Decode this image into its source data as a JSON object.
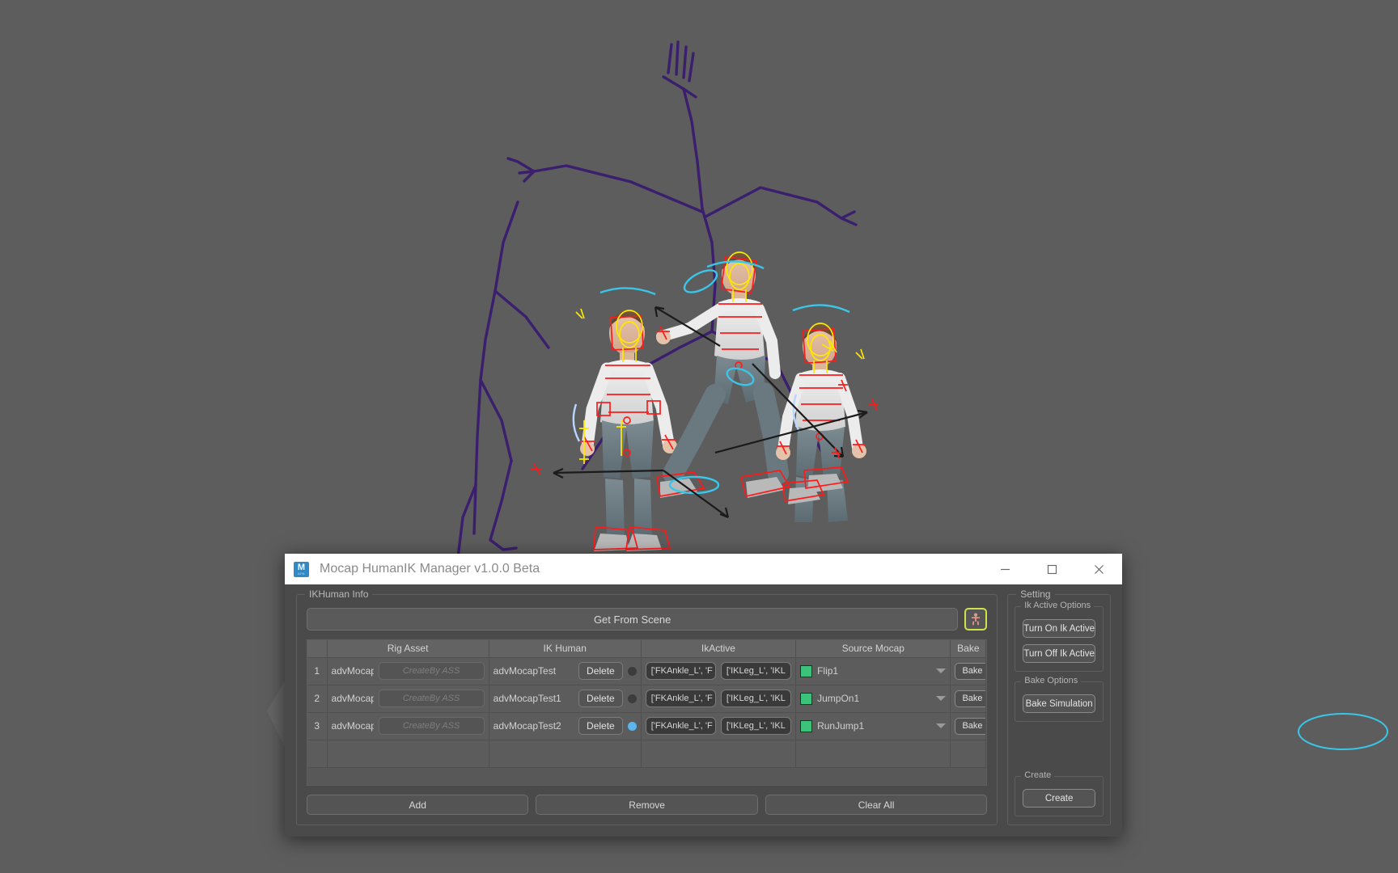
{
  "window": {
    "title": "Mocap HumanIK Manager v1.0.0 Beta",
    "icon_name": "maya-app-icon",
    "icon_letter": "M",
    "icon_sublabel": "APA",
    "controls": {
      "minimize": "minimize-icon",
      "maximize": "maximize-icon",
      "close": "close-icon"
    }
  },
  "ikhuman_info": {
    "group_title": "IKHuman Info",
    "get_from_scene_label": "Get From Scene",
    "character_button_icon": "human-character-icon",
    "table": {
      "columns": [
        "",
        "Rig Asset",
        "IK Human",
        "IkActive",
        "Source Mocap",
        "Bake"
      ],
      "rows": [
        {
          "index": "1",
          "rig_asset": "advMocap",
          "create_by_placeholder": "CreateBy ASS",
          "ik_human": "advMocapTest",
          "delete_label": "Delete",
          "status": "off",
          "ik_active_1": "['FKAnkle_L', 'F",
          "ik_active_2": "['IKLeg_L', 'IKL",
          "color": "#3cc27a",
          "source_mocap": "Flip1",
          "bake_label": "Bake"
        },
        {
          "index": "2",
          "rig_asset": "advMocap",
          "create_by_placeholder": "CreateBy ASS",
          "ik_human": "advMocapTest1",
          "delete_label": "Delete",
          "status": "off",
          "ik_active_1": "['FKAnkle_L', 'F",
          "ik_active_2": "['IKLeg_L', 'IKL",
          "color": "#3cc27a",
          "source_mocap": "JumpOn1",
          "bake_label": "Bake"
        },
        {
          "index": "3",
          "rig_asset": "advMocap",
          "create_by_placeholder": "CreateBy ASS",
          "ik_human": "advMocapTest2",
          "delete_label": "Delete",
          "status": "on",
          "ik_active_1": "['FKAnkle_L', 'F",
          "ik_active_2": "['IKLeg_L', 'IKL",
          "color": "#3cc27a",
          "source_mocap": "RunJump1",
          "bake_label": "Bake"
        }
      ]
    },
    "bottom_buttons": {
      "add": "Add",
      "remove": "Remove",
      "clear_all": "Clear All"
    }
  },
  "setting": {
    "group_title": "Setting",
    "ik_active_options": {
      "title": "Ik Active Options",
      "turn_on": "Turn On Ik Active",
      "turn_off": "Turn Off Ik Active"
    },
    "bake_options": {
      "title": "Bake Options",
      "bake_simulation": "Bake Simulation"
    },
    "create": {
      "title": "Create",
      "create_label": "Create"
    }
  },
  "colors": {
    "viewport_bg": "#5d5d5d",
    "window_bg": "#4a4a4a",
    "titlebar_bg": "#ffffff",
    "accent_green": "#cfe14b",
    "swatch_green": "#3cc27a",
    "status_active_blue": "#5bb6f0",
    "skeleton_purple": "#3b1f6e",
    "rig_red": "#ff1a1a",
    "rig_yellow": "#ffe800",
    "rig_cyan": "#39c6e8"
  }
}
